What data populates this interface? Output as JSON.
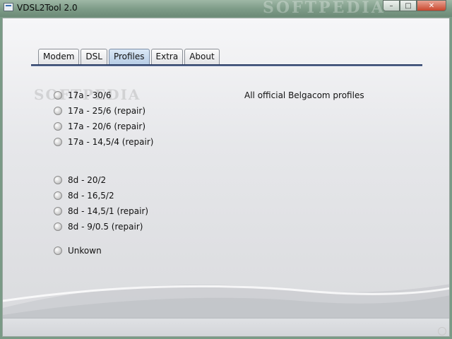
{
  "window": {
    "title": "VDSL2Tool 2.0",
    "watermark": "SOFTPEDIA",
    "buttons": {
      "minimize": "–",
      "maximize": "□",
      "close": "✕"
    }
  },
  "tabs": [
    {
      "label": "Modem",
      "active": false
    },
    {
      "label": "DSL",
      "active": false
    },
    {
      "label": "Profiles",
      "active": true
    },
    {
      "label": "Extra",
      "active": false
    },
    {
      "label": "About",
      "active": false
    }
  ],
  "profiles": {
    "group_17a": [
      "17a - 30/6",
      "17a - 25/6 (repair)",
      "17a - 20/6 (repair)",
      "17a - 14,5/4 (repair)"
    ],
    "group_8d": [
      "8d - 20/2",
      "8d - 16,5/2",
      "8d - 14,5/1 (repair)",
      "8d - 9/0.5 (repair)"
    ],
    "unknown": "Unkown"
  },
  "description": "All official Belgacom profiles",
  "content_watermark": "SOFTPEDIA",
  "colors": {
    "active_tab": "#b7cde6",
    "underline": "#2c3e66"
  }
}
